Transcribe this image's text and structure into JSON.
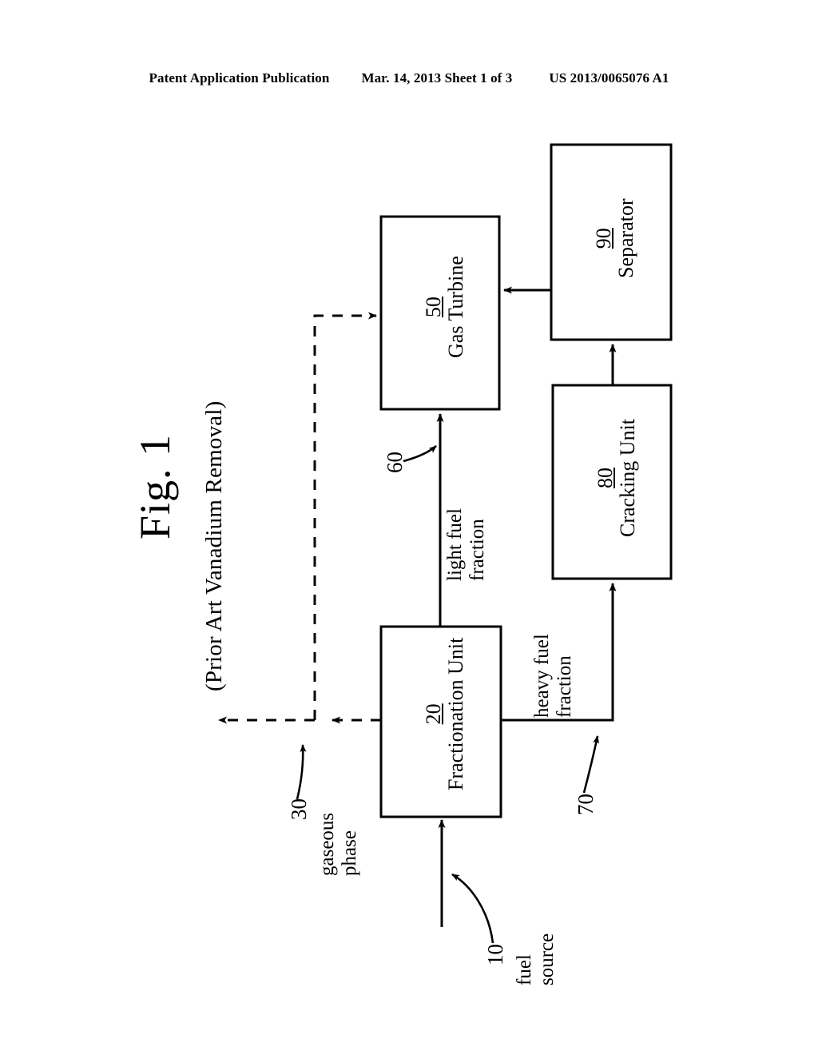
{
  "header": {
    "left": "Patent Application Publication",
    "middle": "Mar. 14, 2013  Sheet 1 of 3",
    "right": "US 2013/0065076 A1"
  },
  "figure": {
    "title": "Fig. 1",
    "subtitle": "(Prior Art Vanadium Removal)",
    "boxes": [
      {
        "id": "gas-turbine",
        "number": "50",
        "name": "Gas Turbine"
      },
      {
        "id": "separator",
        "number": "90",
        "name": "Separator"
      },
      {
        "id": "cracking-unit",
        "number": "80",
        "name": "Cracking Unit"
      },
      {
        "id": "fractionation-unit",
        "number": "20",
        "name": "Fractionation Unit"
      }
    ],
    "flows": [
      {
        "id": "fuel-source",
        "number": "10",
        "line1": "fuel",
        "line2": "source"
      },
      {
        "id": "gaseous-phase",
        "number": "30",
        "line1": "gaseous",
        "line2": "phase"
      },
      {
        "id": "light-fuel-fraction",
        "number": "60",
        "line1": "light fuel",
        "line2": "fraction"
      },
      {
        "id": "heavy-fuel-fraction",
        "number": "70",
        "line1": "heavy fuel",
        "line2": "fraction"
      }
    ],
    "colors": {
      "ink": "#000000",
      "paper": "#ffffff"
    }
  }
}
